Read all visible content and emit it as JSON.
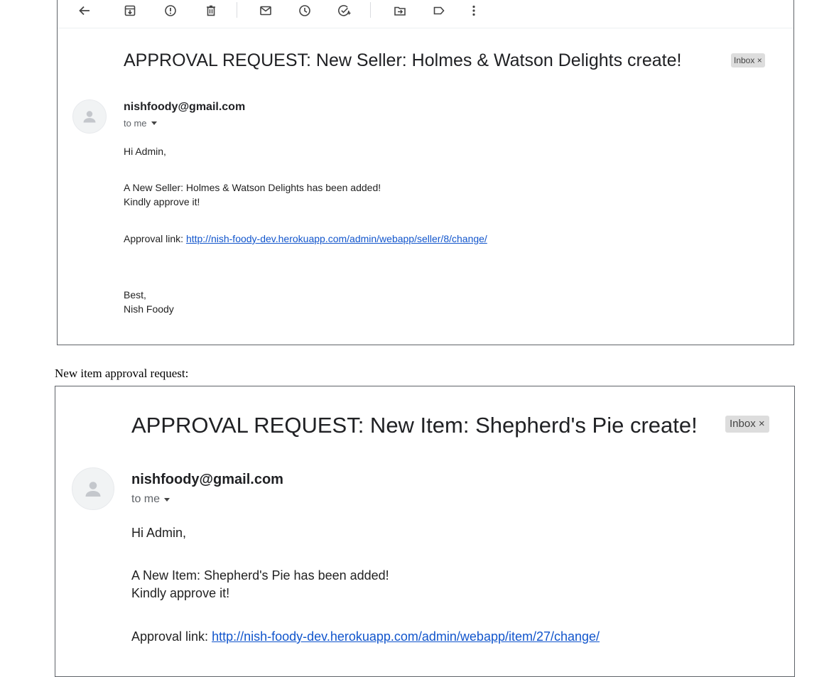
{
  "toolbar": {
    "icons": [
      "back-arrow-icon",
      "archive-icon",
      "report-spam-icon",
      "delete-icon",
      "mark-unread-icon",
      "snooze-icon",
      "add-to-tasks-icon",
      "move-to-icon",
      "labels-icon",
      "more-options-icon"
    ]
  },
  "email1": {
    "subject": "APPROVAL REQUEST: New Seller: Holmes & Watson Delights create!",
    "chip": "Inbox ×",
    "sender": "nishfoody@gmail.com",
    "recipient": "to me",
    "greeting": "Hi Admin,",
    "line1": "A New Seller: Holmes & Watson Delights has been added!",
    "line2": "Kindly approve it!",
    "link_label": "Approval link: ",
    "link_url": "http://nish-foody-dev.herokuapp.com/admin/webapp/seller/8/change/",
    "signoff": "Best,",
    "signature": "Nish Foody"
  },
  "caption": "New item approval request:",
  "email2": {
    "subject": "APPROVAL REQUEST: New Item: Shepherd's Pie create!",
    "chip": "Inbox ×",
    "sender": "nishfoody@gmail.com",
    "recipient": "to me",
    "greeting": "Hi Admin,",
    "line1": "A New Item: Shepherd's Pie has been added!",
    "line2": "Kindly approve it!",
    "link_label": "Approval link: ",
    "link_url": "http://nish-foody-dev.herokuapp.com/admin/webapp/item/27/change/"
  }
}
